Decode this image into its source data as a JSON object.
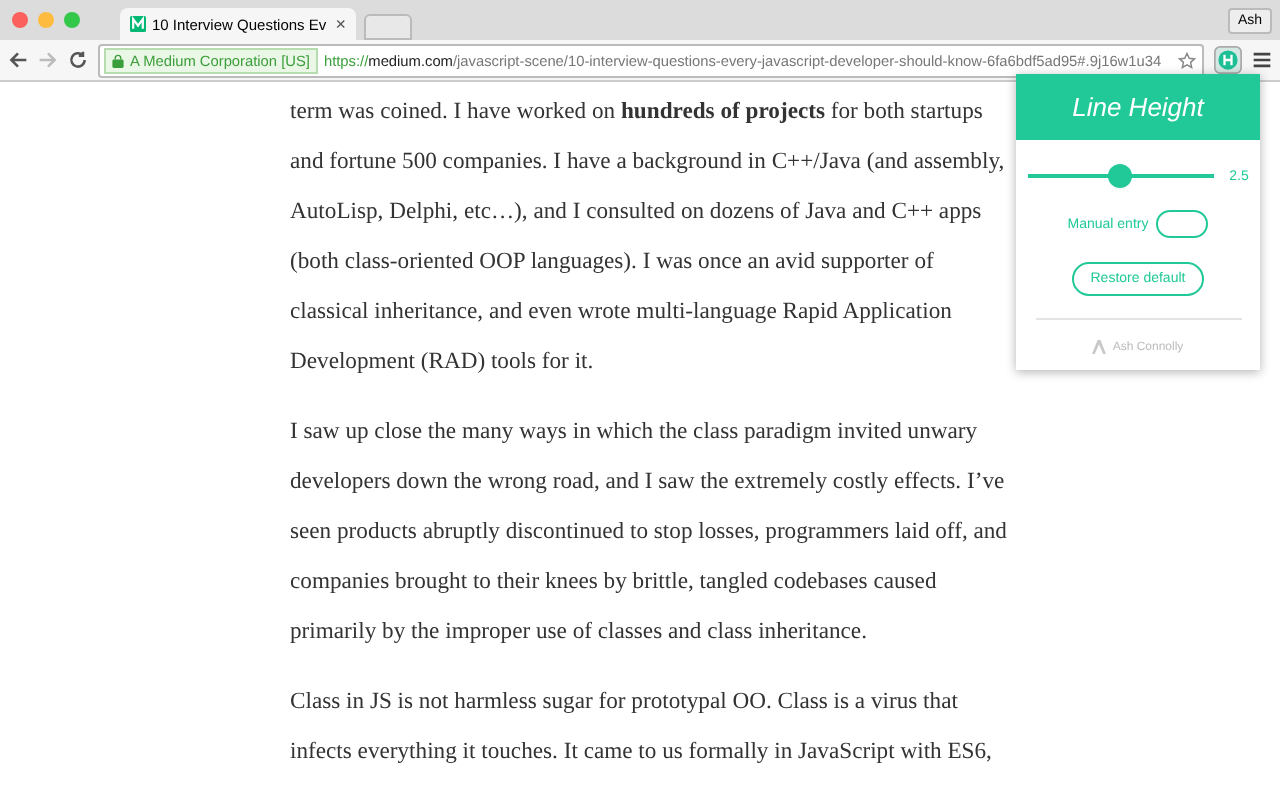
{
  "tab": {
    "title": "10 Interview Questions Ev",
    "close": "×"
  },
  "profile": "Ash",
  "address_bar": {
    "certificate": "A Medium Corporation [US]",
    "scheme": "https://",
    "domain": "medium.com",
    "path": "/javascript-scene/10-interview-questions-every-javascript-developer-should-know-6fa6bdf5ad95#.9j16w1u34"
  },
  "article": {
    "paragraphs": [
      "term was coined. I have worked on **hundreds of projects** for both startups and fortune 500 companies. I have a background in C++/Java (and assembly, AutoLisp, Delphi, etc…), and I consulted on dozens of Java and C++ apps (both class-oriented OOP languages). I was once an avid supporter of classical inheritance, and even wrote multi-language Rapid Application Development (RAD) tools for it.",
      "I saw up close the many ways in which the class paradigm invited unwary developers down the wrong road, and I saw the extremely costly effects. I’ve seen products abruptly discontinued to stop losses, programmers laid off, and companies brought to their knees by brittle, tangled codebases caused primarily by the improper use of classes and class inheritance.",
      "Class in JS is not harmless sugar for prototypal OO. Class is a virus that infects everything it touches. It came to us formally in JavaScript with ES6,"
    ]
  },
  "popup": {
    "title": "Line Height",
    "slider": {
      "level": 0.5
    },
    "reading": "2.5",
    "manual_entry": {
      "label": "Manual entry"
    },
    "restore_button": "Restore default",
    "author": "Ash Connolly"
  }
}
